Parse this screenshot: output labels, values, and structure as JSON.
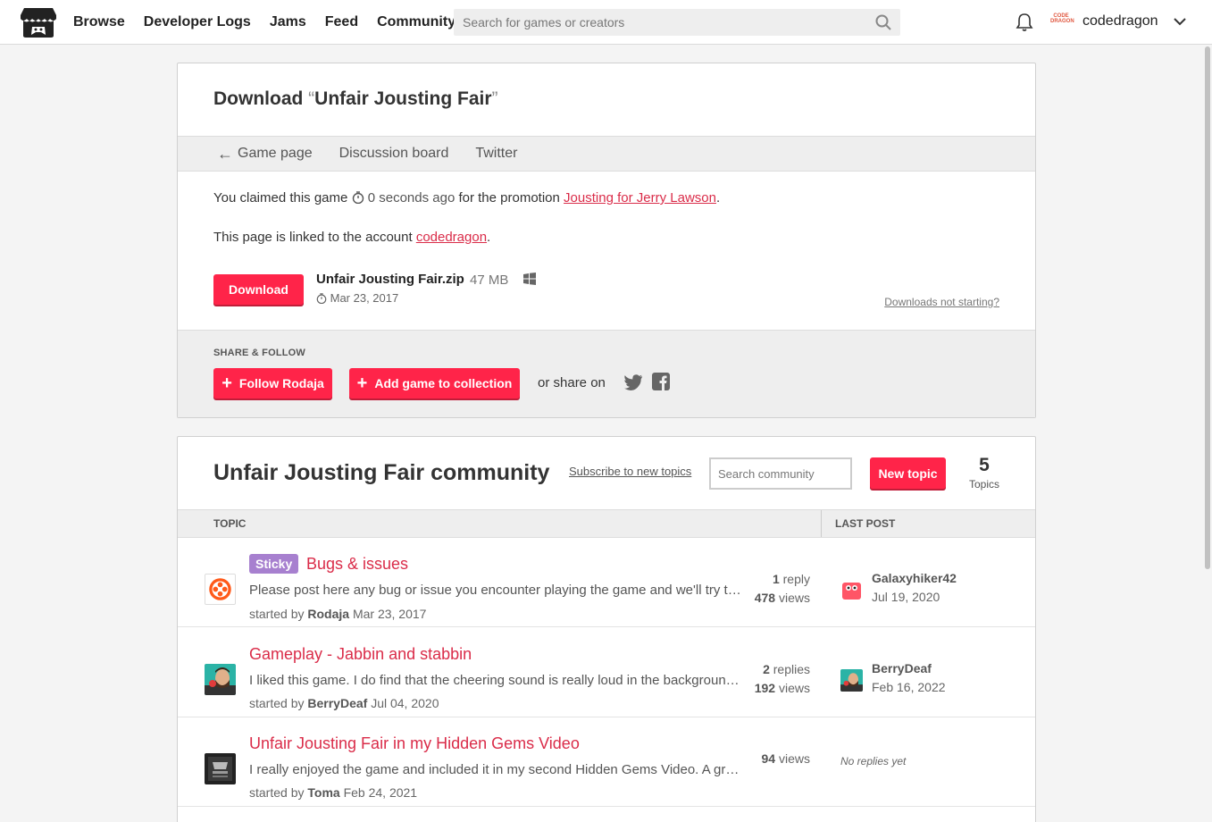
{
  "nav": {
    "items": [
      "Browse",
      "Developer Logs",
      "Jams",
      "Feed",
      "Community"
    ],
    "search_placeholder": "Search for games or creators",
    "user_avatar_text": "CODE DRAGON",
    "username": "codedragon"
  },
  "download": {
    "title_prefix": "Download",
    "title_open_quote": "“",
    "game_title": "Unfair Jousting Fair",
    "title_close_quote": "”",
    "tabs": [
      "Game page",
      "Discussion board",
      "Twitter"
    ],
    "claimed_prefix": "You claimed this game",
    "claimed_time": "0 seconds ago",
    "claimed_middle": "for the promotion",
    "promotion": "Jousting for Jerry Lawson",
    "claimed_suffix": ".",
    "linked_prefix": "This page is linked to the account",
    "linked_account": "codedragon",
    "linked_suffix": ".",
    "download_button": "Download",
    "file_name": "Unfair Jousting Fair.zip",
    "file_size": "47 MB",
    "file_date": "Mar 23, 2017",
    "not_starting": "Downloads not starting?"
  },
  "share": {
    "label": "SHARE & FOLLOW",
    "follow_button": "Follow Rodaja",
    "collection_button": "Add game to collection",
    "or_share": "or share on"
  },
  "community": {
    "title": "Unfair Jousting Fair community",
    "subscribe": "Subscribe to new topics",
    "search_placeholder": "Search community",
    "new_topic": "New topic",
    "topic_count": "5",
    "topic_count_label": "Topics",
    "col_topic": "TOPIC",
    "col_last_post": "LAST POST",
    "rows": [
      {
        "sticky": "Sticky",
        "title": "Bugs & issues",
        "desc": "Please post here any bug or issue you encounter playing the game and we'll try to fix it as soon as possible.",
        "started_by": "started by",
        "author": "Rodaja",
        "date": "Mar 23, 2017",
        "replies_num": "1",
        "replies_lbl": "reply",
        "views_num": "478",
        "views_lbl": "views",
        "last_user": "Galaxyhiker42",
        "last_date": "Jul 19, 2020"
      },
      {
        "title": "Gameplay - Jabbin and stabbin",
        "desc": "I liked this game. I do find that the cheering sound is really loud in the background though.",
        "started_by": "started by",
        "author": "BerryDeaf",
        "date": "Jul 04, 2020",
        "replies_num": "2",
        "replies_lbl": "replies",
        "views_num": "192",
        "views_lbl": "views",
        "last_user": "BerryDeaf",
        "last_date": "Feb 16, 2022"
      },
      {
        "title": "Unfair Jousting Fair in my Hidden Gems Video",
        "desc": "I really enjoyed the game and included it in my second Hidden Gems Video. A great little game.",
        "started_by": "started by",
        "author": "Toma",
        "date": "Feb 24, 2021",
        "views_num": "94",
        "views_lbl": "views",
        "no_replies": "No replies yet"
      }
    ]
  },
  "colors": {
    "accent": "#ff2449",
    "link": "#da2c49",
    "sticky": "#a780cf"
  }
}
